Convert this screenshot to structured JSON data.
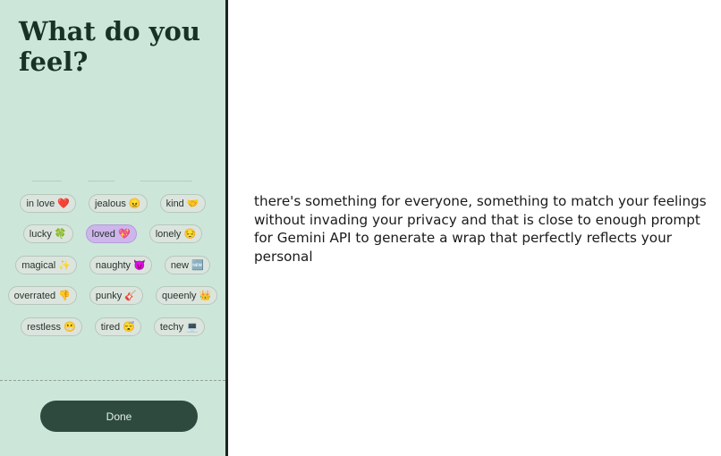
{
  "panel": {
    "title": "What do you feel?",
    "rows": [
      [
        {
          "label": "in love ❤️",
          "selected": false
        },
        {
          "label": "jealous 😠",
          "selected": false
        },
        {
          "label": "kind 🤝",
          "selected": false
        }
      ],
      [
        {
          "label": "lucky 🍀",
          "selected": false
        },
        {
          "label": "loved 💖",
          "selected": true
        },
        {
          "label": "lonely 😔",
          "selected": false
        }
      ],
      [
        {
          "label": "magical ✨",
          "selected": false
        },
        {
          "label": "naughty 😈",
          "selected": false
        },
        {
          "label": "new 🆕",
          "selected": false
        }
      ],
      [
        {
          "label": "overrated 👎",
          "selected": false
        },
        {
          "label": "punky 🎸",
          "selected": false
        },
        {
          "label": "queenly 👑",
          "selected": false
        }
      ],
      [
        {
          "label": "restless 😬",
          "selected": false
        },
        {
          "label": "tired 😴",
          "selected": false
        },
        {
          "label": "techy 💻",
          "selected": false
        }
      ]
    ],
    "done_label": "Done"
  },
  "main": {
    "description": "there's something for everyone, something to match your feelings without invading your privacy and that is close to enough prompt for Gemini API to generate a wrap that perfectly reflects your personal"
  }
}
